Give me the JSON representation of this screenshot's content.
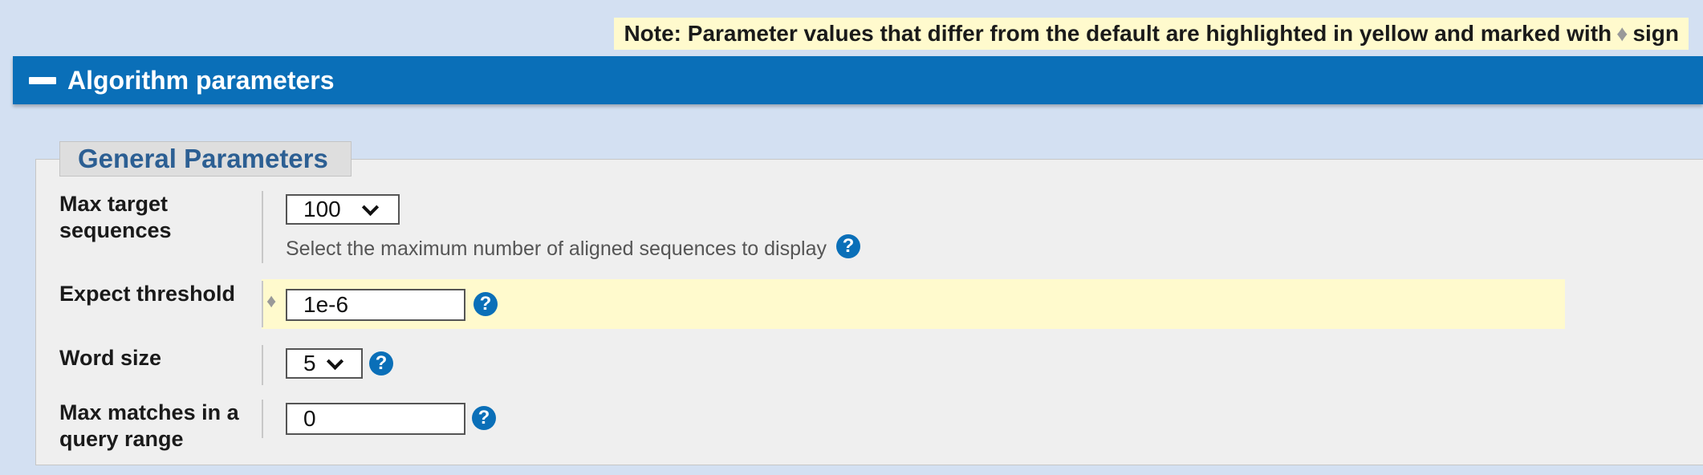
{
  "note": {
    "prefix": "Note: Parameter values that differ from the default are highlighted in yellow and marked with",
    "diamond": "♦",
    "suffix": "sign"
  },
  "section": {
    "title": "Algorithm parameters"
  },
  "group": {
    "title": "General Parameters"
  },
  "params": {
    "max_target": {
      "label": "Max target sequences",
      "value": "100",
      "hint": "Select the maximum number of aligned sequences to display"
    },
    "expect": {
      "label": "Expect threshold",
      "value": "1e-6",
      "modified_marker": "♦"
    },
    "word_size": {
      "label": "Word size",
      "value": "5"
    },
    "max_matches": {
      "label": "Max matches in a query range",
      "value": "0"
    }
  },
  "icons": {
    "help": "?"
  },
  "colors": {
    "header": "#0a6fb8",
    "highlight": "#fffacd",
    "legend_text": "#2c5f93"
  }
}
